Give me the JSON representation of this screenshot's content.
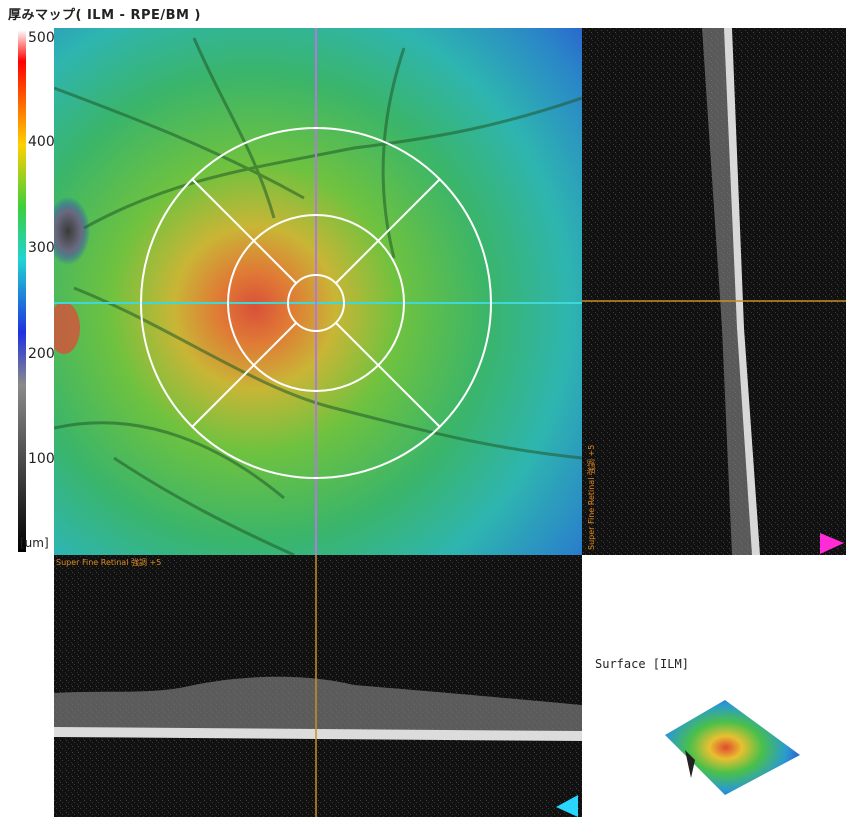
{
  "title": "厚みマップ( ILM - RPE/BM )",
  "scale": {
    "ticks": [
      {
        "label": "500",
        "value": 500
      },
      {
        "label": "400",
        "value": 400
      },
      {
        "label": "300",
        "value": 300
      },
      {
        "label": "200",
        "value": 200
      },
      {
        "label": "100",
        "value": 100
      }
    ],
    "unit": "[um]",
    "range": [
      0,
      500
    ]
  },
  "bscan_vertical": {
    "label": "Super Fine Retinal 強調 +5"
  },
  "bscan_horizontal": {
    "label": "Super Fine Retinal 強調 +5"
  },
  "surface": {
    "label": "Surface [ILM]"
  },
  "colors": {
    "crosshair_map_h": "#3fd7d7",
    "crosshair_map_v": "#b07ad8",
    "crosshair_scan": "#c8902a",
    "marker_vertical": "#ff2bd6",
    "marker_horizontal": "#28d6ff"
  }
}
